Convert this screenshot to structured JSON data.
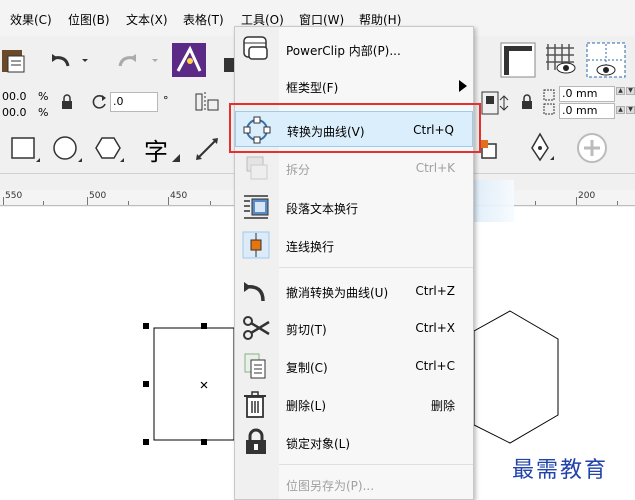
{
  "menubar": {
    "items": [
      "效果(C)",
      "位图(B)",
      "文本(X)",
      "表格(T)",
      "工具(O)",
      "窗口(W)",
      "帮助(H)"
    ]
  },
  "toolbar": {
    "pos_x": "00.0",
    "pos_y": "00.0",
    "percent_1": "%",
    "percent_2": "%",
    "rotation": ".0",
    "degree": "°",
    "mm_1": ".0 mm",
    "mm_2": ".0 mm",
    "text_tool_glyph": "字"
  },
  "ruler": {
    "labels": [
      "550",
      "500",
      "450",
      "200"
    ]
  },
  "context_menu": {
    "items": [
      {
        "label": "PowerClip 内部(P)...",
        "shortcut": "",
        "icon": "powerclip-icon"
      },
      {
        "label": "框类型(F)",
        "shortcut": "",
        "icon": "",
        "submenu": true
      },
      {
        "label": "转换为曲线(V)",
        "shortcut": "Ctrl+Q",
        "icon": "convert-to-curves-icon",
        "highlighted": true
      },
      {
        "label": "拆分",
        "shortcut": "Ctrl+K",
        "icon": "break-apart-icon",
        "disabled": true
      },
      {
        "label": "段落文本换行",
        "shortcut": "",
        "icon": "paragraph-wrap-icon"
      },
      {
        "label": "连线换行",
        "shortcut": "",
        "icon": "line-wrap-icon"
      },
      {
        "label": "撤消转换为曲线(U)",
        "shortcut": "Ctrl+Z",
        "icon": "undo-icon"
      },
      {
        "label": "剪切(T)",
        "shortcut": "Ctrl+X",
        "icon": "scissors-icon"
      },
      {
        "label": "复制(C)",
        "shortcut": "Ctrl+C",
        "icon": "copy-icon"
      },
      {
        "label": "删除(L)",
        "shortcut": "删除",
        "icon": "trash-icon"
      },
      {
        "label": "锁定对象(L)",
        "shortcut": "",
        "icon": "lock-icon"
      },
      {
        "label": "位图另存为(P)...",
        "shortcut": "",
        "icon": "",
        "disabled": true
      }
    ]
  },
  "watermark": "最需教育",
  "colors": {
    "highlight_bg": "#dbeefb",
    "highlight_border": "#9ccbee",
    "annotation_red": "#e53030",
    "watermark_blue": "#2244aa"
  }
}
